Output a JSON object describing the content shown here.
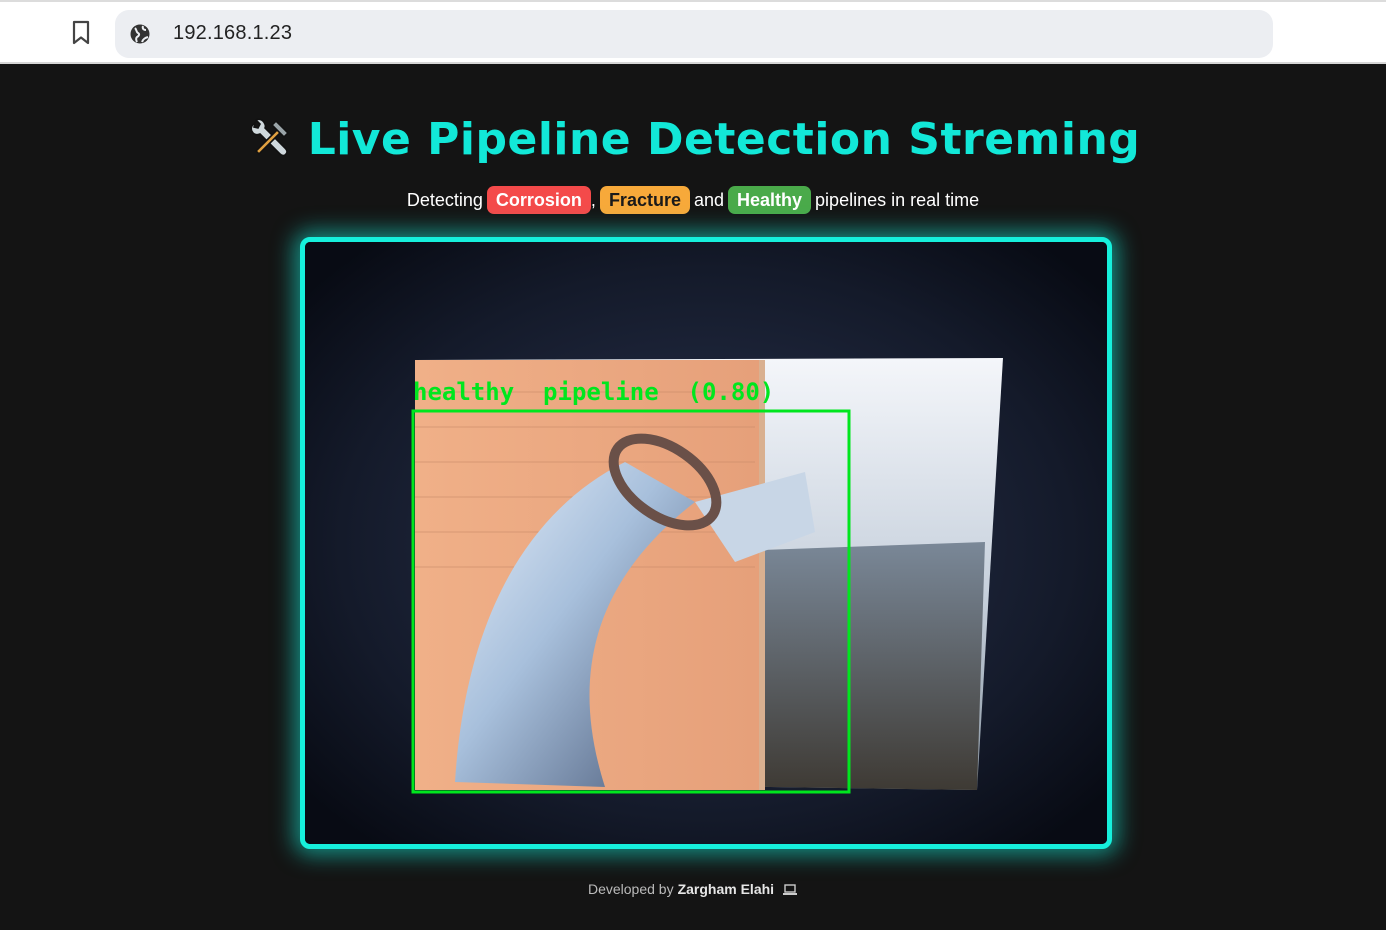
{
  "browser": {
    "url": "192.168.1.23",
    "bookmark_icon": "bookmark-icon",
    "site_icon": "globe-icon"
  },
  "header": {
    "icon": "hammer-wrench-icon",
    "title": "Live Pipeline Detection Streming"
  },
  "subtitle": {
    "prefix": "Detecting",
    "badge_corrosion": "Corrosion",
    "comma": ",",
    "badge_fracture": "Fracture",
    "and": "and",
    "badge_healthy": "Healthy",
    "suffix": "pipelines in real time",
    "colors": {
      "corrosion": "#f44a4a",
      "fracture": "#f7a93a",
      "healthy": "#4aaa4a"
    }
  },
  "stream": {
    "detection_label": "healthy  pipeline  (0.80)",
    "box_color": "#00e61e",
    "frame_color": "#16f0dc"
  },
  "footer": {
    "prefix": "Developed by",
    "author": "Zargham Elahi",
    "icon": "laptop-icon"
  }
}
